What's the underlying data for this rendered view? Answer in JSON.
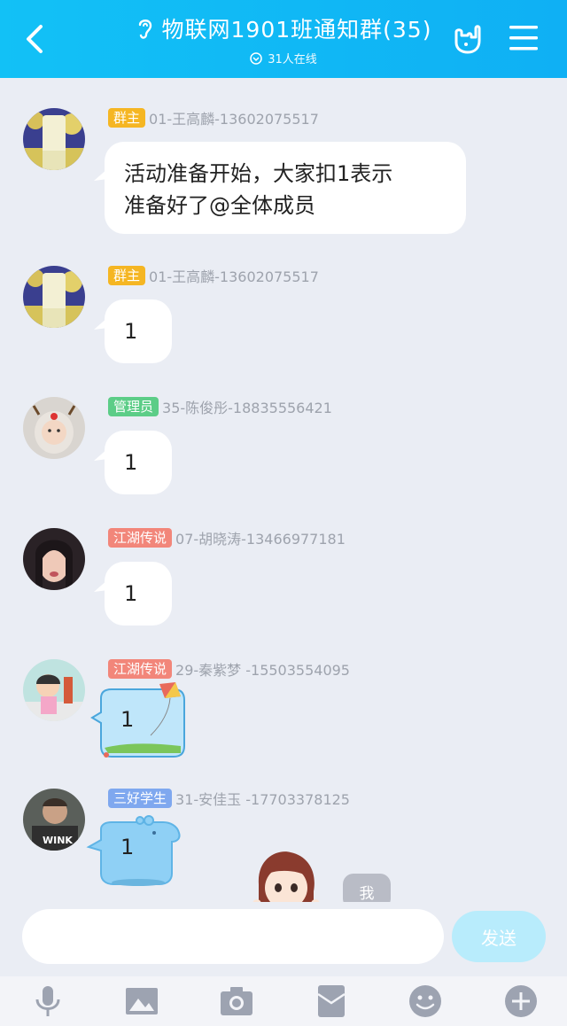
{
  "header": {
    "title": "物联网1901班通知群(35)",
    "subtitle": "31人在线"
  },
  "messages": [
    {
      "badge": "群主",
      "badge_color": "#f5b623",
      "sender": "01-王高麟-13602075517",
      "text_lines": [
        "活动准备开始，大家扣1表示",
        "准备好了@全体成员"
      ]
    },
    {
      "badge": "群主",
      "badge_color": "#f5b623",
      "sender": "01-王高麟-13602075517",
      "text": "1"
    },
    {
      "badge": "管理员",
      "badge_color": "#5ccd87",
      "sender": "35-陈俊彤-18835556421",
      "text": "1"
    },
    {
      "badge": "江湖传说",
      "badge_color": "#f2867a",
      "sender": "07-胡晓涛-13466977181",
      "text": "1"
    },
    {
      "badge": "江湖传说",
      "badge_color": "#f2867a",
      "sender": "29-秦紫梦 -15503554095",
      "text": "1"
    },
    {
      "badge": "三好学生",
      "badge_color": "#7fa8ef",
      "sender": "31-安佳玉 -17703378125",
      "text": "1",
      "avatar_caption": "WINK"
    }
  ],
  "self_badge": "我",
  "composer": {
    "placeholder": "",
    "send_label": "发送"
  },
  "toolbar": {
    "icons": [
      "microphone-icon",
      "image-icon",
      "camera-icon",
      "red-packet-icon",
      "emoji-icon",
      "plus-icon"
    ]
  }
}
